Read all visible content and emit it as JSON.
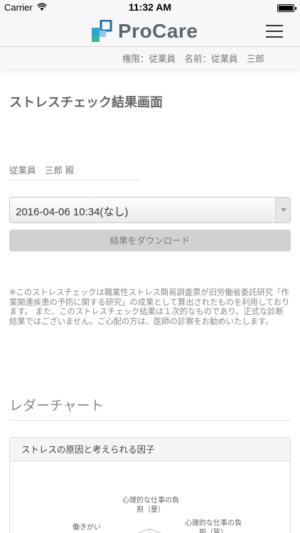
{
  "status_bar": {
    "carrier": "Carrier",
    "time": "11:32 AM"
  },
  "header": {
    "logo_text": "ProCare",
    "logo_colors": [
      "#2aa7d6",
      "#1d6fb0",
      "#3bb3a1",
      "#8fc9e3"
    ]
  },
  "user_info": {
    "text": "権限：従業員　名前：従業員　三郎"
  },
  "main": {
    "page_title": "ストレスチェック結果画面",
    "employee_name": "従業員　三郎 殿",
    "date_select_value": "2016-04-06 10:34(なし)",
    "download_label": "結果をダウンロード",
    "disclaimer": "※このストレスチェックは職業性ストレス簡易調査票が旧労働省委託研究「作業関連疾患の予防に関する研究」の成果として算出されたものを利用しております。 また、このストレスチェック結果は１次的なものであり、正式な診断結果ではございません。ご心配の方は、医師の診察をお勧めいたします。",
    "chart_section_title": "レダーチャート",
    "panel_heading": "ストレスの原因と考えられる因子",
    "radar_labels": {
      "top": "心理的な仕事の負担（量）",
      "right": "心理的な仕事の負担（質）",
      "left": "働きがい"
    }
  }
}
